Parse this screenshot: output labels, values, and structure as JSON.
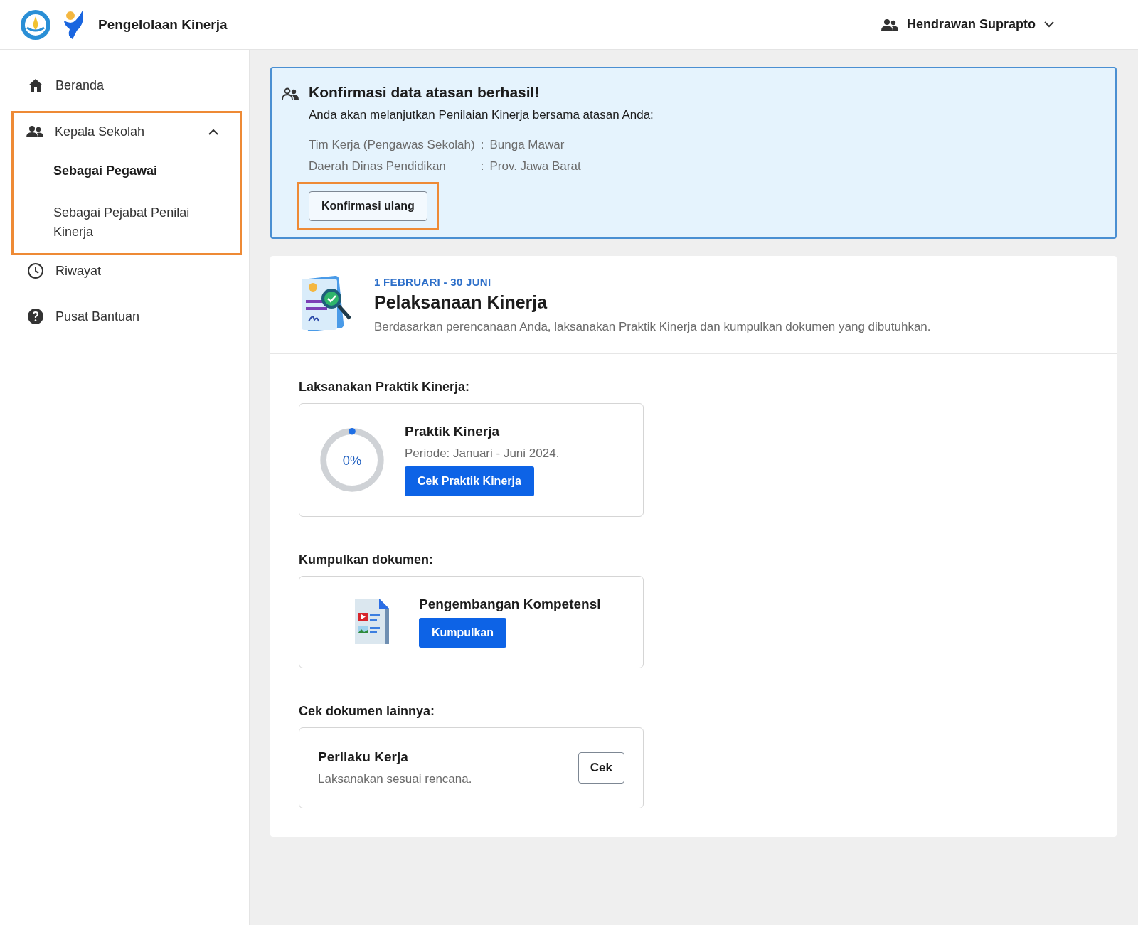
{
  "header": {
    "app_title": "Pengelolaan Kinerja",
    "user_name": "Hendrawan Suprapto"
  },
  "sidebar": {
    "items": [
      {
        "kind": "link",
        "label": "Beranda"
      },
      {
        "kind": "group",
        "label": "Kepala Sekolah",
        "expanded": true,
        "highlighted": true,
        "children": [
          {
            "label": "Sebagai Pegawai",
            "selected": true
          },
          {
            "label": "Sebagai Pejabat Penilai Kinerja",
            "selected": false
          }
        ]
      },
      {
        "kind": "link",
        "label": "Riwayat"
      },
      {
        "kind": "link",
        "label": "Pusat Bantuan"
      }
    ]
  },
  "alert": {
    "title": "Konfirmasi data atasan berhasil!",
    "message": "Anda akan melanjutkan Penilaian Kinerja bersama atasan Anda:",
    "fields": [
      {
        "label": "Tim Kerja (Pengawas Sekolah)",
        "separator": ":",
        "value": "Bunga Mawar"
      },
      {
        "label": "Daerah Dinas Pendidikan",
        "separator": ":",
        "value": "Prov. Jawa Barat"
      }
    ],
    "button": {
      "label": "Konfirmasi ulang",
      "highlighted": true
    }
  },
  "card": {
    "date_range": "1 FEBRUARI - 30 JUNI",
    "title": "Pelaksanaan Kinerja",
    "description": "Berdasarkan perencanaan Anda, laksanakan Praktik Kinerja dan kumpulkan dokumen yang dibutuhkan.",
    "sections": [
      {
        "kind": "progress",
        "heading": "Laksanakan Praktik Kinerja:",
        "title": "Praktik Kinerja",
        "subtitle": "Periode: Januari - Juni 2024.",
        "level": 0,
        "percent": "0%",
        "button": "Cek Praktik Kinerja"
      },
      {
        "kind": "document",
        "heading": "Kumpulkan dokumen:",
        "title": "Pengembangan Kompetensi",
        "button": "Kumpulkan"
      },
      {
        "kind": "check",
        "heading": "Cek dokumen lainnya:",
        "title": "Perilaku Kerja",
        "subtitle": "Laksanakan sesuai rencana.",
        "button": "Cek"
      }
    ]
  }
}
